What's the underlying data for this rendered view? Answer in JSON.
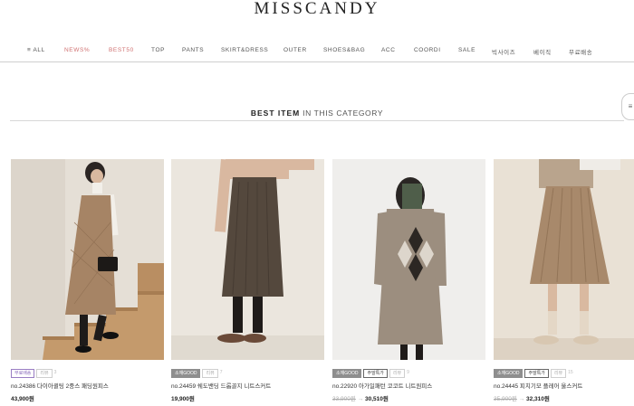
{
  "header": {
    "logo": "MISSCANDY"
  },
  "nav": {
    "items": [
      {
        "label": "≡ ALL",
        "color": "#555555"
      },
      {
        "label": "NEWS%",
        "color": "#d07171"
      },
      {
        "label": "BEST50",
        "color": "#d07171"
      },
      {
        "label": "TOP",
        "color": "#555555"
      },
      {
        "label": "PANTS",
        "color": "#555555"
      },
      {
        "label": "SKIRT&DRESS",
        "color": "#555555"
      },
      {
        "label": "OUTER",
        "color": "#555555"
      },
      {
        "label": "SHOES&BAG",
        "color": "#555555"
      },
      {
        "label": "ACC",
        "color": "#555555"
      },
      {
        "label": "COORDI",
        "color": "#555555"
      },
      {
        "label": "SALE",
        "color": "#555555"
      },
      {
        "label": "빅사이즈",
        "color": "#555555"
      },
      {
        "label": "베이직",
        "color": "#555555"
      },
      {
        "label": "무료배송",
        "color": "#555555"
      }
    ]
  },
  "side_tab": {
    "icon": "menu-icon"
  },
  "section": {
    "title_bold": "BEST ITEM",
    "title_rest": " IN THIS CATEGORY"
  },
  "products": [
    {
      "tags": [
        {
          "text": "무료배송",
          "style": "purple"
        },
        {
          "text": "리뷰",
          "style": "light"
        },
        {
          "text": "3",
          "style": "count"
        }
      ],
      "name": "no.24386 다이아퀼팅 2중스 패딩원피스",
      "price": "43,900원",
      "old_price": "",
      "arrow": ""
    },
    {
      "tags": [
        {
          "text": "소재GOOD",
          "style": "gray"
        },
        {
          "text": "리뷰",
          "style": "light"
        },
        {
          "text": "7",
          "style": "count"
        }
      ],
      "name": "no.24459 쉐도밴딩 드롭골지 니트스커트",
      "price": "19,900원",
      "old_price": "",
      "arrow": ""
    },
    {
      "tags": [
        {
          "text": "소재GOOD",
          "style": "gray"
        },
        {
          "text": "주말특가",
          "style": "outline"
        },
        {
          "text": "리뷰",
          "style": "light"
        },
        {
          "text": "9",
          "style": "count"
        }
      ],
      "name": "no.22920 아가일패턴 코코트 니트원피스",
      "price": "30,510원",
      "old_price": "33,900원",
      "arrow": "→"
    },
    {
      "tags": [
        {
          "text": "소재GOOD",
          "style": "gray"
        },
        {
          "text": "주말특가",
          "style": "outline"
        },
        {
          "text": "리뷰",
          "style": "light"
        },
        {
          "text": "15",
          "style": "count"
        }
      ],
      "name": "no.24445 피치기모 플레어 울스커트",
      "price": "32,310원",
      "old_price": "35,900원",
      "arrow": "→"
    }
  ]
}
